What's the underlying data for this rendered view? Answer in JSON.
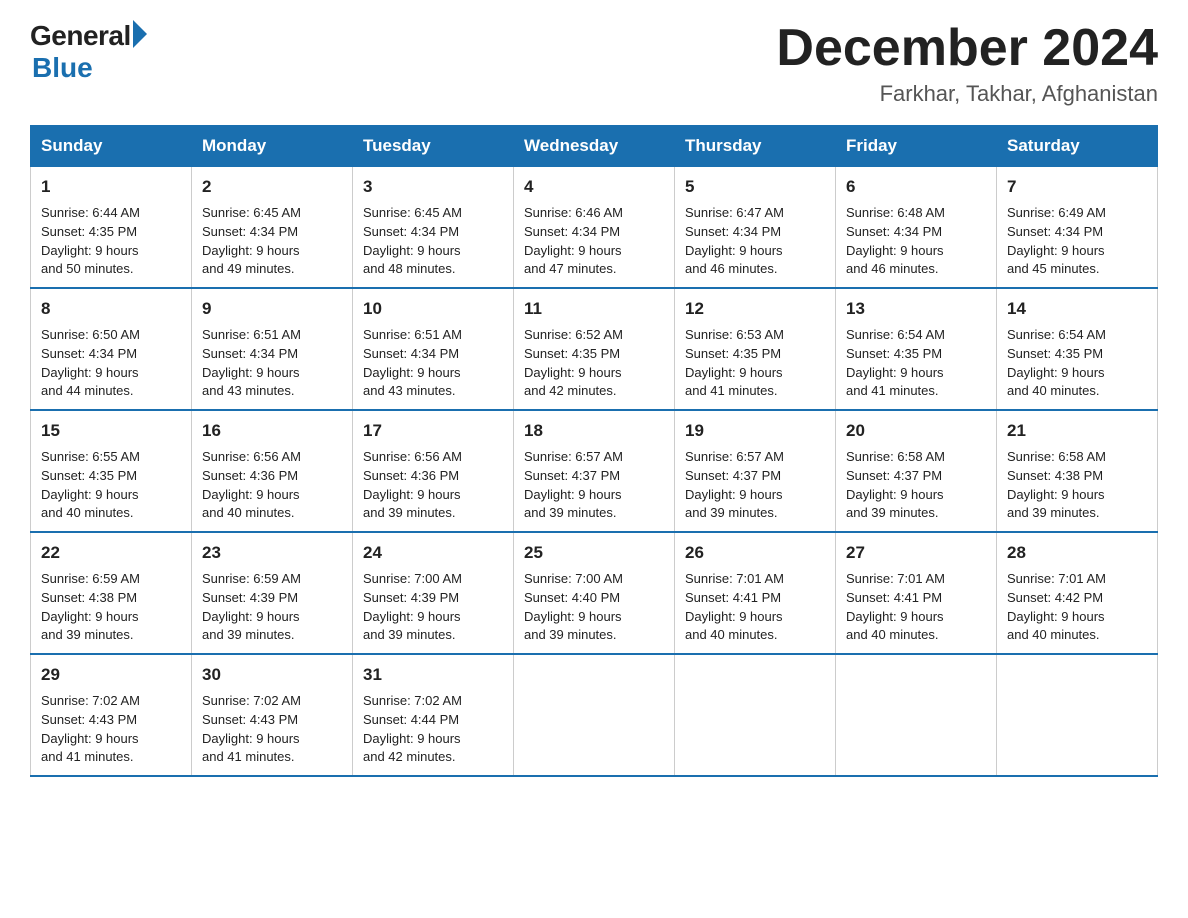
{
  "header": {
    "logo_general": "General",
    "logo_blue": "Blue",
    "month_year": "December 2024",
    "location": "Farkhar, Takhar, Afghanistan"
  },
  "days_of_week": [
    "Sunday",
    "Monday",
    "Tuesday",
    "Wednesday",
    "Thursday",
    "Friday",
    "Saturday"
  ],
  "weeks": [
    [
      {
        "num": "1",
        "sunrise": "6:44 AM",
        "sunset": "4:35 PM",
        "daylight": "9 hours and 50 minutes."
      },
      {
        "num": "2",
        "sunrise": "6:45 AM",
        "sunset": "4:34 PM",
        "daylight": "9 hours and 49 minutes."
      },
      {
        "num": "3",
        "sunrise": "6:45 AM",
        "sunset": "4:34 PM",
        "daylight": "9 hours and 48 minutes."
      },
      {
        "num": "4",
        "sunrise": "6:46 AM",
        "sunset": "4:34 PM",
        "daylight": "9 hours and 47 minutes."
      },
      {
        "num": "5",
        "sunrise": "6:47 AM",
        "sunset": "4:34 PM",
        "daylight": "9 hours and 46 minutes."
      },
      {
        "num": "6",
        "sunrise": "6:48 AM",
        "sunset": "4:34 PM",
        "daylight": "9 hours and 46 minutes."
      },
      {
        "num": "7",
        "sunrise": "6:49 AM",
        "sunset": "4:34 PM",
        "daylight": "9 hours and 45 minutes."
      }
    ],
    [
      {
        "num": "8",
        "sunrise": "6:50 AM",
        "sunset": "4:34 PM",
        "daylight": "9 hours and 44 minutes."
      },
      {
        "num": "9",
        "sunrise": "6:51 AM",
        "sunset": "4:34 PM",
        "daylight": "9 hours and 43 minutes."
      },
      {
        "num": "10",
        "sunrise": "6:51 AM",
        "sunset": "4:34 PM",
        "daylight": "9 hours and 43 minutes."
      },
      {
        "num": "11",
        "sunrise": "6:52 AM",
        "sunset": "4:35 PM",
        "daylight": "9 hours and 42 minutes."
      },
      {
        "num": "12",
        "sunrise": "6:53 AM",
        "sunset": "4:35 PM",
        "daylight": "9 hours and 41 minutes."
      },
      {
        "num": "13",
        "sunrise": "6:54 AM",
        "sunset": "4:35 PM",
        "daylight": "9 hours and 41 minutes."
      },
      {
        "num": "14",
        "sunrise": "6:54 AM",
        "sunset": "4:35 PM",
        "daylight": "9 hours and 40 minutes."
      }
    ],
    [
      {
        "num": "15",
        "sunrise": "6:55 AM",
        "sunset": "4:35 PM",
        "daylight": "9 hours and 40 minutes."
      },
      {
        "num": "16",
        "sunrise": "6:56 AM",
        "sunset": "4:36 PM",
        "daylight": "9 hours and 40 minutes."
      },
      {
        "num": "17",
        "sunrise": "6:56 AM",
        "sunset": "4:36 PM",
        "daylight": "9 hours and 39 minutes."
      },
      {
        "num": "18",
        "sunrise": "6:57 AM",
        "sunset": "4:37 PM",
        "daylight": "9 hours and 39 minutes."
      },
      {
        "num": "19",
        "sunrise": "6:57 AM",
        "sunset": "4:37 PM",
        "daylight": "9 hours and 39 minutes."
      },
      {
        "num": "20",
        "sunrise": "6:58 AM",
        "sunset": "4:37 PM",
        "daylight": "9 hours and 39 minutes."
      },
      {
        "num": "21",
        "sunrise": "6:58 AM",
        "sunset": "4:38 PM",
        "daylight": "9 hours and 39 minutes."
      }
    ],
    [
      {
        "num": "22",
        "sunrise": "6:59 AM",
        "sunset": "4:38 PM",
        "daylight": "9 hours and 39 minutes."
      },
      {
        "num": "23",
        "sunrise": "6:59 AM",
        "sunset": "4:39 PM",
        "daylight": "9 hours and 39 minutes."
      },
      {
        "num": "24",
        "sunrise": "7:00 AM",
        "sunset": "4:39 PM",
        "daylight": "9 hours and 39 minutes."
      },
      {
        "num": "25",
        "sunrise": "7:00 AM",
        "sunset": "4:40 PM",
        "daylight": "9 hours and 39 minutes."
      },
      {
        "num": "26",
        "sunrise": "7:01 AM",
        "sunset": "4:41 PM",
        "daylight": "9 hours and 40 minutes."
      },
      {
        "num": "27",
        "sunrise": "7:01 AM",
        "sunset": "4:41 PM",
        "daylight": "9 hours and 40 minutes."
      },
      {
        "num": "28",
        "sunrise": "7:01 AM",
        "sunset": "4:42 PM",
        "daylight": "9 hours and 40 minutes."
      }
    ],
    [
      {
        "num": "29",
        "sunrise": "7:02 AM",
        "sunset": "4:43 PM",
        "daylight": "9 hours and 41 minutes."
      },
      {
        "num": "30",
        "sunrise": "7:02 AM",
        "sunset": "4:43 PM",
        "daylight": "9 hours and 41 minutes."
      },
      {
        "num": "31",
        "sunrise": "7:02 AM",
        "sunset": "4:44 PM",
        "daylight": "9 hours and 42 minutes."
      },
      null,
      null,
      null,
      null
    ]
  ],
  "labels": {
    "sunrise": "Sunrise:",
    "sunset": "Sunset:",
    "daylight": "Daylight:"
  }
}
